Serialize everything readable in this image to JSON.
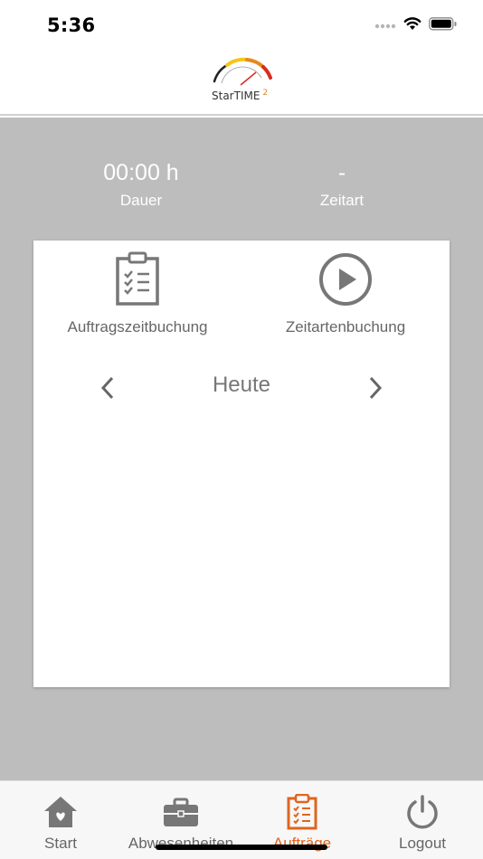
{
  "status_bar": {
    "time": "5:36"
  },
  "logo": {
    "text": "StarTIME",
    "superscript": "2"
  },
  "summary": {
    "duration_value": "00:00 h",
    "duration_label": "Dauer",
    "type_value": "-",
    "type_label": "Zeitart"
  },
  "actions": {
    "orders_label": "Auftragszeitbuchung",
    "types_label": "Zeitartenbuchung"
  },
  "date_nav": {
    "label": "Heute"
  },
  "tabs": [
    {
      "label": "Start",
      "icon": "home-icon"
    },
    {
      "label": "Abwesenheiten",
      "icon": "briefcase-icon"
    },
    {
      "label": "Aufträge",
      "icon": "clipboard-icon",
      "active": true
    },
    {
      "label": "Logout",
      "icon": "power-icon"
    }
  ],
  "colors": {
    "accent": "#e1641d",
    "background": "#bdbdbd",
    "icon_gray": "#777777"
  }
}
